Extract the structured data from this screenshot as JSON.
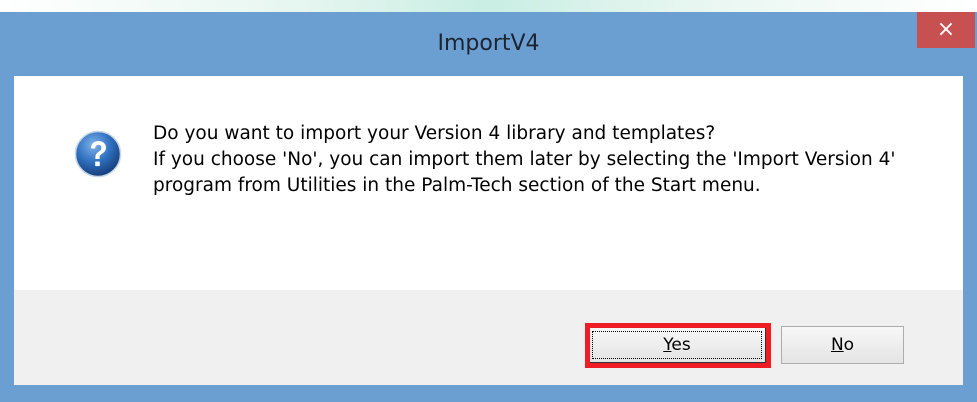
{
  "window": {
    "title": "ImportV4",
    "close_glyph": "×",
    "colors": {
      "frame": "#6b9fd2",
      "close": "#c75050",
      "highlight": "#ee1c24"
    }
  },
  "dialog": {
    "icon": "question-icon",
    "line1": "Do you want to import your Version 4 library and templates?",
    "line2": "If you choose 'No', you can import them later by selecting the 'Import Version 4' program from Utilities in the Palm-Tech section of the Start menu."
  },
  "buttons": {
    "yes": {
      "mnemonic": "Y",
      "rest": "es"
    },
    "no": {
      "mnemonic": "N",
      "rest": "o"
    }
  }
}
